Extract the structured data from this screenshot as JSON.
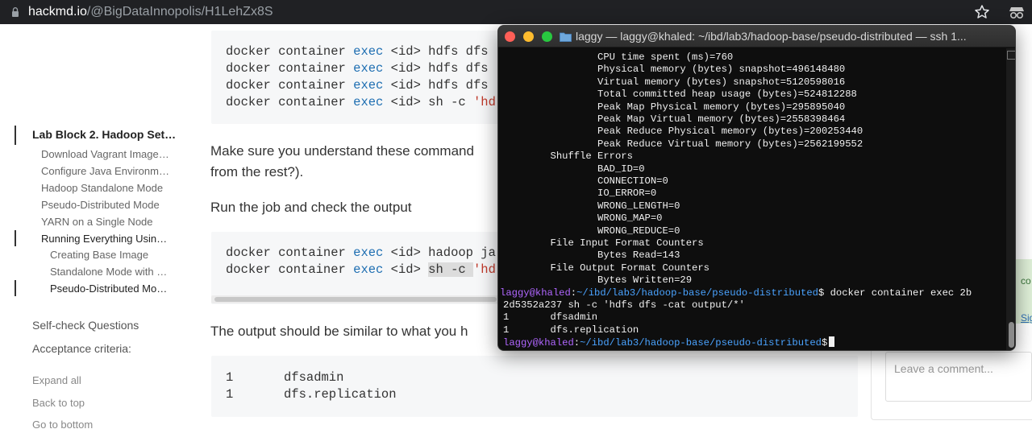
{
  "browser": {
    "url_host": "hackmd.io",
    "url_path": "/@BigDataInnopolis/H1LehZx8S"
  },
  "toc": {
    "items": [
      {
        "label": "Lab Block 2. Hadoop Set…",
        "level": 0
      },
      {
        "label": "Download Vagrant Image…",
        "level": 1
      },
      {
        "label": "Configure Java Environm…",
        "level": 1
      },
      {
        "label": "Hadoop Standalone Mode",
        "level": 1
      },
      {
        "label": "Pseudo-Distributed Mode",
        "level": 1
      },
      {
        "label": "YARN on a Single Node",
        "level": 1
      },
      {
        "label": "Running Everything Usin…",
        "level": 1
      },
      {
        "label": "Creating Base Image",
        "level": 2
      },
      {
        "label": "Standalone Mode with …",
        "level": 2
      },
      {
        "label": "Pseudo-Distributed Mo…",
        "level": 2
      }
    ],
    "self_check": "Self-check Questions",
    "acceptance": "Acceptance criteria:",
    "expand_all": "Expand all",
    "back_to_top": "Back to top",
    "go_to_bottom": "Go to bottom"
  },
  "content": {
    "code1": [
      {
        "pre": "docker container ",
        "kw": "exec",
        "post": " <id> hdfs dfs",
        "str": ""
      },
      {
        "pre": "docker container ",
        "kw": "exec",
        "post": " <id> hdfs dfs",
        "str": ""
      },
      {
        "pre": "docker container ",
        "kw": "exec",
        "post": " <id> hdfs dfs",
        "str": ""
      },
      {
        "pre": "docker container ",
        "kw": "exec",
        "post": " <id> sh -c ",
        "str": "'hd"
      }
    ],
    "para1_line1": "Make sure you understand these command",
    "para1_line2": "from the rest?).",
    "para2": "Run the job and check the output",
    "code2": [
      {
        "pre": "docker container ",
        "kw": "exec",
        "post": " <id> hadoop ja",
        "sel": "",
        "str": ""
      },
      {
        "pre": "docker container ",
        "kw": "exec",
        "post": " <id> ",
        "sel": "sh -c ",
        "str": "'hd"
      }
    ],
    "para3": "The output should be similar to what you h",
    "code3": [
      {
        "n": "1",
        "v": "dfsadmin"
      },
      {
        "n": "1",
        "v": "dfs.replication"
      }
    ]
  },
  "comment": {
    "placeholder": "Leave a comment...",
    "side_text1": "co",
    "side_text2": "Sigr"
  },
  "terminal": {
    "title": "laggy — laggy@khaled: ~/ibd/lab3/hadoop-base/pseudo-distributed — ssh 1...",
    "lines": [
      "                CPU time spent (ms)=760",
      "                Physical memory (bytes) snapshot=496148480",
      "                Virtual memory (bytes) snapshot=5120598016",
      "                Total committed heap usage (bytes)=524812288",
      "                Peak Map Physical memory (bytes)=295895040",
      "                Peak Map Virtual memory (bytes)=2558398464",
      "                Peak Reduce Physical memory (bytes)=200253440",
      "                Peak Reduce Virtual memory (bytes)=2562199552",
      "        Shuffle Errors",
      "                BAD_ID=0",
      "                CONNECTION=0",
      "                IO_ERROR=0",
      "                WRONG_LENGTH=0",
      "                WRONG_MAP=0",
      "                WRONG_REDUCE=0",
      "        File Input Format Counters",
      "                Bytes Read=143",
      "        File Output Format Counters",
      "                Bytes Written=29"
    ],
    "prompt_user": "laggy@khaled",
    "prompt_path": "~/ibd/lab3/hadoop-base/pseudo-distributed",
    "prompt_sym": "$",
    "command": " docker container exec 2b",
    "wrap": "2d5352a237 sh -c 'hdfs dfs -cat output/*'",
    "out1": "1       dfsadmin",
    "out2": "1       dfs.replication",
    "colors": {
      "user": "#b066ff",
      "path": "#4aa3ff",
      "bg": "#0e0e0e"
    }
  }
}
